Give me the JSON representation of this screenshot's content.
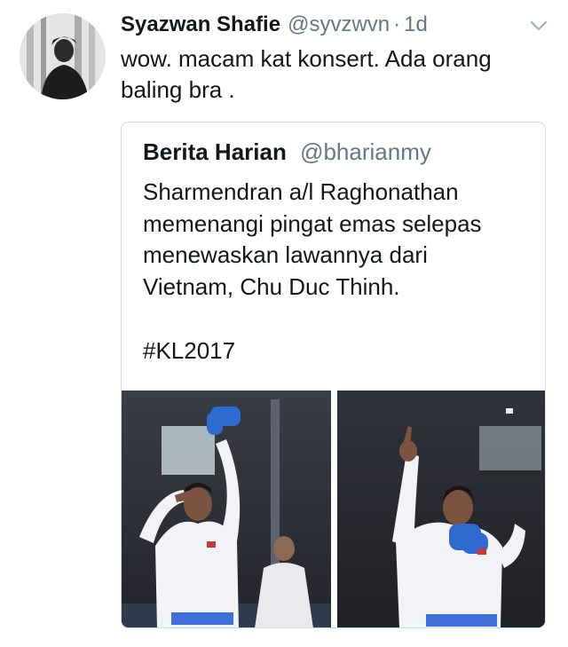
{
  "tweet": {
    "author_name": "Syazwan Shafie",
    "author_handle": "@syvzwvn",
    "separator": "·",
    "timestamp": "1d",
    "text_line1": "wow. macam kat konsert. Ada orang",
    "text_line2": "baling bra ."
  },
  "quoted": {
    "author_name": "Berita Harian",
    "author_handle": "@bharianmy",
    "text_line1": "Sharmendran a/l Raghonathan",
    "text_line2": "memenangi pingat emas selepas",
    "text_line3": "menewaskan lawannya dari",
    "text_line4": "Vietnam, Chu Duc Thinh.",
    "hashtag": "#KL2017"
  },
  "icons": {
    "caret": "chevron-down-icon"
  },
  "colors": {
    "text": "#14171a",
    "secondary": "#657786",
    "border": "#d3dbe2"
  }
}
